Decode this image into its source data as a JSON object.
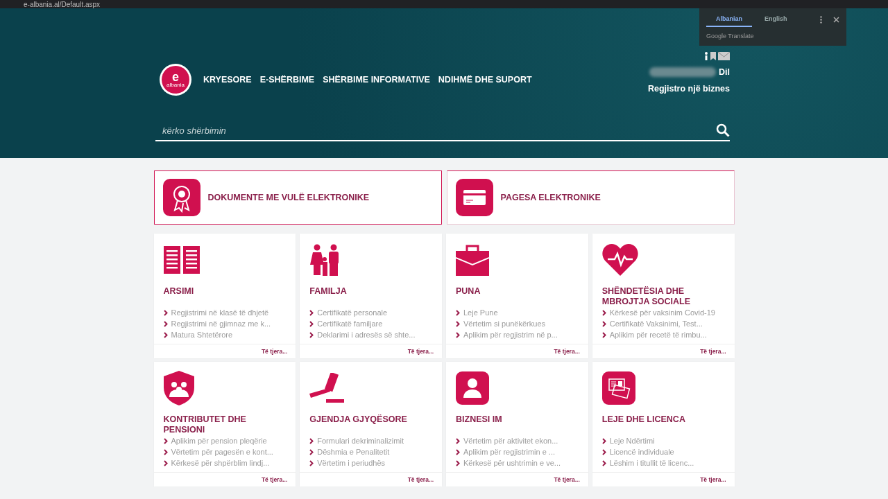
{
  "browser": {
    "url": "e-albania.al/Default.aspx"
  },
  "translate_popup": {
    "tabs": [
      {
        "label": "Albanian",
        "selected": true
      },
      {
        "label": "English",
        "selected": false
      }
    ],
    "footer": "Google Translate"
  },
  "header": {
    "logo": {
      "letter": "e",
      "word": "albania"
    },
    "nav": [
      "KRYESORE",
      "E-SHËRBIME",
      "SHËRBIME INFORMATIVE",
      "NDIHMË DHE SUPORT"
    ],
    "user": {
      "logout": "Dil",
      "register": "Regjistro një biznes"
    },
    "search": {
      "placeholder": "kërko shërbimin"
    }
  },
  "featured": [
    {
      "title": "DOKUMENTE ME VULË ELEKTRONIKE"
    },
    {
      "title": "PAGESA ELEKTRONIKE"
    }
  ],
  "categories": [
    {
      "title": "ARSIMI",
      "items": [
        "Regjistrimi në klasë të dhjetë",
        "Regjistrimi në gjimnaz me k...",
        "Matura Shtetërore"
      ],
      "more": "Të tjera..."
    },
    {
      "title": "FAMILJA",
      "items": [
        "Certifikatë personale",
        "Certifikatë familjare",
        "Deklarimi i adresës së shte..."
      ],
      "more": "Të tjera..."
    },
    {
      "title": "PUNA",
      "items": [
        "Leje Pune",
        "Vërtetim si punëkërkues",
        "Aplikim për regjistrim në p..."
      ],
      "more": "Të tjera..."
    },
    {
      "title": "SHËNDETËSIA DHE MBROJTJA SOCIALE",
      "items": [
        "Kërkesë për vaksinim Covid-19",
        "Certifikatë Vaksinimi, Test...",
        "Aplikim për recetë të rimbu..."
      ],
      "more": "Të tjera..."
    },
    {
      "title": "KONTRIBUTET DHE PENSIONI",
      "items": [
        "Aplikim për pension pleqërie",
        "Vërtetim për pagesën e kont...",
        "Kërkesë për shpërblim lindj..."
      ],
      "more": "Të tjera..."
    },
    {
      "title": "GJENDJA GJYQËSORE",
      "items": [
        "Formulari dekriminalizimit",
        "Dëshmia e Penalitetit",
        "Vërtetim i periudhës"
      ],
      "more": "Të tjera..."
    },
    {
      "title": "BIZNESI IM",
      "items": [
        "Vërtetim për aktivitet ekon...",
        "Aplikim për regjistrimin e ...",
        "Kërkesë për ushtrimin e ve..."
      ],
      "more": "Të tjera..."
    },
    {
      "title": "LEJE DHE LICENCA",
      "items": [
        "Leje Ndërtimi",
        "Licencë individuale",
        "Lëshim i titullit të licenc..."
      ],
      "more": "Të tjera..."
    }
  ]
}
